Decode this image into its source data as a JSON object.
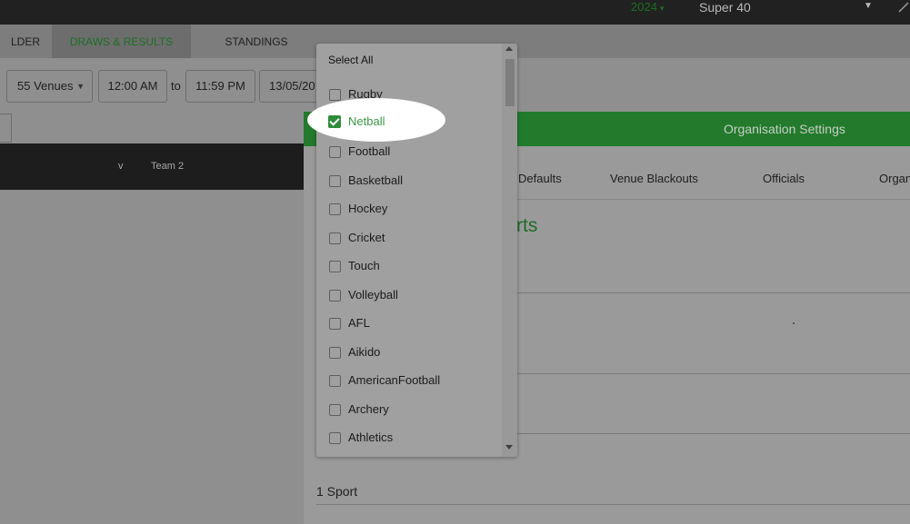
{
  "topbar": {
    "year": "2024",
    "competition": "Super 40"
  },
  "tabs": [
    {
      "label": "LDER"
    },
    {
      "label": "DRAWS & RESULTS"
    },
    {
      "label": "STANDINGS"
    }
  ],
  "filters": {
    "venues": "55 Venues",
    "time_from": "12:00 AM",
    "to_label": "to",
    "time_to": "11:59 PM",
    "date_from": "13/05/20"
  },
  "draw_header": {
    "v": "v",
    "team2": "Team 2"
  },
  "panel": {
    "title": "Organisation Settings",
    "tabs": [
      "Defaults",
      "Venue Blackouts",
      "Officials",
      "Organ"
    ],
    "heading": "rts",
    "sport_count": "1 Sport"
  },
  "dropdown": {
    "select_all": "Select All",
    "options": [
      {
        "label": "Rugby",
        "checked": false
      },
      {
        "label": "Netball",
        "checked": true
      },
      {
        "label": "Football",
        "checked": false
      },
      {
        "label": "Basketball",
        "checked": false
      },
      {
        "label": "Hockey",
        "checked": false
      },
      {
        "label": "Cricket",
        "checked": false
      },
      {
        "label": "Touch",
        "checked": false
      },
      {
        "label": "Volleyball",
        "checked": false
      },
      {
        "label": "AFL",
        "checked": false
      },
      {
        "label": "Aikido",
        "checked": false
      },
      {
        "label": "AmericanFootball",
        "checked": false
      },
      {
        "label": "Archery",
        "checked": false
      },
      {
        "label": "Athletics",
        "checked": false
      }
    ]
  },
  "colors": {
    "accent_green": "#2e8a38",
    "header_green": "#237a2c",
    "topbar": "#212121"
  }
}
